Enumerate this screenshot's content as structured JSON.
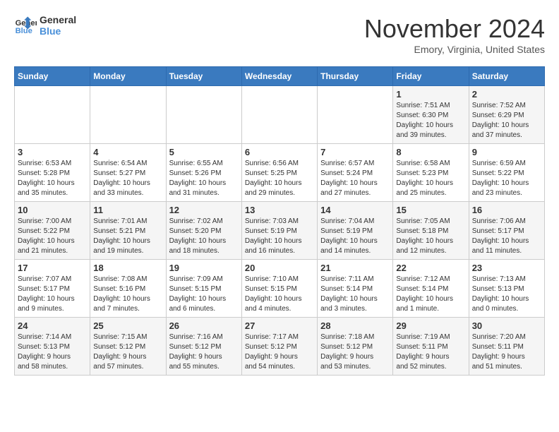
{
  "logo": {
    "line1": "General",
    "line2": "Blue"
  },
  "title": "November 2024",
  "location": "Emory, Virginia, United States",
  "days_header": [
    "Sunday",
    "Monday",
    "Tuesday",
    "Wednesday",
    "Thursday",
    "Friday",
    "Saturday"
  ],
  "weeks": [
    [
      {
        "day": "",
        "content": ""
      },
      {
        "day": "",
        "content": ""
      },
      {
        "day": "",
        "content": ""
      },
      {
        "day": "",
        "content": ""
      },
      {
        "day": "",
        "content": ""
      },
      {
        "day": "1",
        "content": "Sunrise: 7:51 AM\nSunset: 6:30 PM\nDaylight: 10 hours\nand 39 minutes."
      },
      {
        "day": "2",
        "content": "Sunrise: 7:52 AM\nSunset: 6:29 PM\nDaylight: 10 hours\nand 37 minutes."
      }
    ],
    [
      {
        "day": "3",
        "content": "Sunrise: 6:53 AM\nSunset: 5:28 PM\nDaylight: 10 hours\nand 35 minutes."
      },
      {
        "day": "4",
        "content": "Sunrise: 6:54 AM\nSunset: 5:27 PM\nDaylight: 10 hours\nand 33 minutes."
      },
      {
        "day": "5",
        "content": "Sunrise: 6:55 AM\nSunset: 5:26 PM\nDaylight: 10 hours\nand 31 minutes."
      },
      {
        "day": "6",
        "content": "Sunrise: 6:56 AM\nSunset: 5:25 PM\nDaylight: 10 hours\nand 29 minutes."
      },
      {
        "day": "7",
        "content": "Sunrise: 6:57 AM\nSunset: 5:24 PM\nDaylight: 10 hours\nand 27 minutes."
      },
      {
        "day": "8",
        "content": "Sunrise: 6:58 AM\nSunset: 5:23 PM\nDaylight: 10 hours\nand 25 minutes."
      },
      {
        "day": "9",
        "content": "Sunrise: 6:59 AM\nSunset: 5:22 PM\nDaylight: 10 hours\nand 23 minutes."
      }
    ],
    [
      {
        "day": "10",
        "content": "Sunrise: 7:00 AM\nSunset: 5:22 PM\nDaylight: 10 hours\nand 21 minutes."
      },
      {
        "day": "11",
        "content": "Sunrise: 7:01 AM\nSunset: 5:21 PM\nDaylight: 10 hours\nand 19 minutes."
      },
      {
        "day": "12",
        "content": "Sunrise: 7:02 AM\nSunset: 5:20 PM\nDaylight: 10 hours\nand 18 minutes."
      },
      {
        "day": "13",
        "content": "Sunrise: 7:03 AM\nSunset: 5:19 PM\nDaylight: 10 hours\nand 16 minutes."
      },
      {
        "day": "14",
        "content": "Sunrise: 7:04 AM\nSunset: 5:19 PM\nDaylight: 10 hours\nand 14 minutes."
      },
      {
        "day": "15",
        "content": "Sunrise: 7:05 AM\nSunset: 5:18 PM\nDaylight: 10 hours\nand 12 minutes."
      },
      {
        "day": "16",
        "content": "Sunrise: 7:06 AM\nSunset: 5:17 PM\nDaylight: 10 hours\nand 11 minutes."
      }
    ],
    [
      {
        "day": "17",
        "content": "Sunrise: 7:07 AM\nSunset: 5:17 PM\nDaylight: 10 hours\nand 9 minutes."
      },
      {
        "day": "18",
        "content": "Sunrise: 7:08 AM\nSunset: 5:16 PM\nDaylight: 10 hours\nand 7 minutes."
      },
      {
        "day": "19",
        "content": "Sunrise: 7:09 AM\nSunset: 5:15 PM\nDaylight: 10 hours\nand 6 minutes."
      },
      {
        "day": "20",
        "content": "Sunrise: 7:10 AM\nSunset: 5:15 PM\nDaylight: 10 hours\nand 4 minutes."
      },
      {
        "day": "21",
        "content": "Sunrise: 7:11 AM\nSunset: 5:14 PM\nDaylight: 10 hours\nand 3 minutes."
      },
      {
        "day": "22",
        "content": "Sunrise: 7:12 AM\nSunset: 5:14 PM\nDaylight: 10 hours\nand 1 minute."
      },
      {
        "day": "23",
        "content": "Sunrise: 7:13 AM\nSunset: 5:13 PM\nDaylight: 10 hours\nand 0 minutes."
      }
    ],
    [
      {
        "day": "24",
        "content": "Sunrise: 7:14 AM\nSunset: 5:13 PM\nDaylight: 9 hours\nand 58 minutes."
      },
      {
        "day": "25",
        "content": "Sunrise: 7:15 AM\nSunset: 5:12 PM\nDaylight: 9 hours\nand 57 minutes."
      },
      {
        "day": "26",
        "content": "Sunrise: 7:16 AM\nSunset: 5:12 PM\nDaylight: 9 hours\nand 55 minutes."
      },
      {
        "day": "27",
        "content": "Sunrise: 7:17 AM\nSunset: 5:12 PM\nDaylight: 9 hours\nand 54 minutes."
      },
      {
        "day": "28",
        "content": "Sunrise: 7:18 AM\nSunset: 5:12 PM\nDaylight: 9 hours\nand 53 minutes."
      },
      {
        "day": "29",
        "content": "Sunrise: 7:19 AM\nSunset: 5:11 PM\nDaylight: 9 hours\nand 52 minutes."
      },
      {
        "day": "30",
        "content": "Sunrise: 7:20 AM\nSunset: 5:11 PM\nDaylight: 9 hours\nand 51 minutes."
      }
    ]
  ]
}
